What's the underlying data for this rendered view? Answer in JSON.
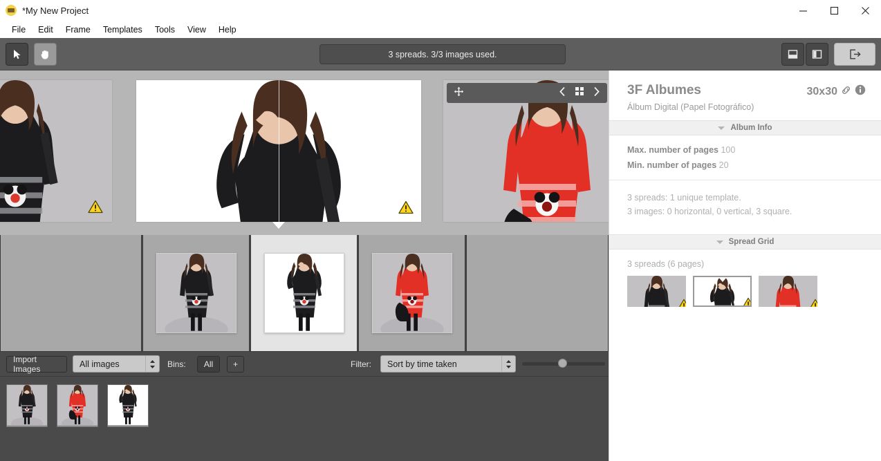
{
  "window": {
    "title": "*My New Project",
    "app_icon": "album-app-icon",
    "controls": {
      "minimize": "minimize-icon",
      "maximize": "maximize-icon",
      "close": "close-icon"
    }
  },
  "menubar": {
    "items": [
      {
        "label": "File"
      },
      {
        "label": "Edit"
      },
      {
        "label": "Frame"
      },
      {
        "label": "Templates"
      },
      {
        "label": "Tools"
      },
      {
        "label": "View"
      },
      {
        "label": "Help"
      }
    ]
  },
  "toolbar": {
    "select_tool": {
      "icon": "cursor-arrow-icon",
      "active": true
    },
    "pan_tool": {
      "icon": "hand-icon",
      "active": false
    },
    "status_text": "3 spreads. 3/3 images used.",
    "view_horizontal": {
      "icon": "split-horizontal-icon",
      "active": false
    },
    "view_vertical": {
      "icon": "split-vertical-icon",
      "active": false
    },
    "panel_toggle": {
      "icon": "panel-export-icon",
      "active": true
    }
  },
  "canvas": {
    "float_toolbar": {
      "move_icon": "move-cross-icon",
      "prev_icon": "chevron-left-icon",
      "grid_icon": "grid-view-icon",
      "next_icon": "chevron-right-icon"
    },
    "spreads": [
      {
        "name": "spread-1",
        "selected": false,
        "warning": "warning-triangle-icon",
        "variant": "black-dress-grey-bg"
      },
      {
        "name": "spread-2",
        "selected": true,
        "warning": "warning-triangle-icon",
        "variant": "black-dress-white-bg"
      },
      {
        "name": "spread-3",
        "selected": false,
        "warning": "warning-triangle-icon",
        "variant": "red-dress-grey-bg"
      }
    ]
  },
  "filmstrip": {
    "panels": [
      {
        "name": "filmstrip-spread-1",
        "selected": false,
        "variant": "black-dress-grey-bg"
      },
      {
        "name": "filmstrip-spread-2",
        "selected": true,
        "variant": "black-dress-white-bg"
      },
      {
        "name": "filmstrip-spread-3",
        "selected": false,
        "variant": "red-dress-grey-bg"
      }
    ]
  },
  "bottombar": {
    "import_label": "Import Images",
    "image_filter_value": "All images",
    "bins_label": "Bins:",
    "bins_all_label": "All",
    "bins_add_label": "+",
    "filter_label": "Filter:",
    "sort_value": "Sort by time taken",
    "zoom_slider_percent": 49
  },
  "imagebin": {
    "thumbnails": [
      {
        "name": "bin-image-1",
        "variant": "black-dress-grey-bg"
      },
      {
        "name": "bin-image-2",
        "variant": "red-dress-grey-bg"
      },
      {
        "name": "bin-image-3",
        "variant": "black-dress-white-bg"
      }
    ]
  },
  "rightpanel": {
    "title": "3F Albumes",
    "size": "30x30",
    "link_icon": "link-chain-icon",
    "info_icon": "info-circle-icon",
    "subtitle": "Álbum Digital (Papel Fotográfico)",
    "album_info_section": "Album Info",
    "max_pages_label": "Max. number of pages",
    "max_pages_value": "100",
    "min_pages_label": "Min. number of pages",
    "min_pages_value": "20",
    "stat_spreads": "3 spreads:  1 unique template.",
    "stat_images": "3 images:  0 horizontal, 0 vertical, 3 square.",
    "spread_grid_section": "Spread Grid",
    "spread_grid_count": "3 spreads (6 pages)",
    "grid_items": [
      {
        "name": "grid-spread-1",
        "selected": false,
        "warning": "warning-triangle-icon",
        "variant": "black-dress-grey-bg"
      },
      {
        "name": "grid-spread-2",
        "selected": true,
        "warning": "warning-triangle-icon",
        "variant": "black-dress-white-bg"
      },
      {
        "name": "grid-spread-3",
        "selected": false,
        "warning": "warning-triangle-icon",
        "variant": "red-dress-grey-bg"
      }
    ]
  },
  "colors": {
    "chrome_dark": "#5e5e5e",
    "panel_dark": "#4a4a4a",
    "canvas_bg": "#b6b6b6",
    "warning_yellow": "#ffd21e",
    "panel_white": "#ffffff"
  }
}
